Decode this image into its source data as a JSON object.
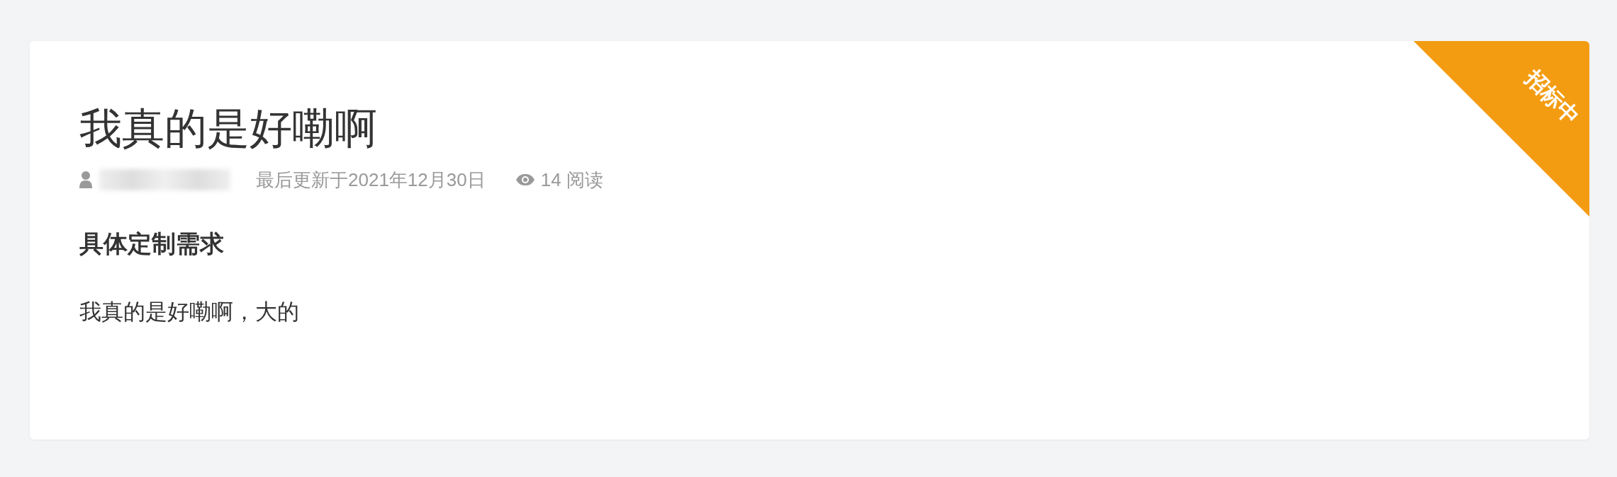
{
  "post": {
    "title": "我真的是好嘞啊",
    "status_ribbon": "招标中",
    "meta": {
      "updated": "最后更新于2021年12月30日",
      "views": "14 阅读"
    },
    "section_heading": "具体定制需求",
    "body": "我真的是好嘞啊，大的"
  }
}
